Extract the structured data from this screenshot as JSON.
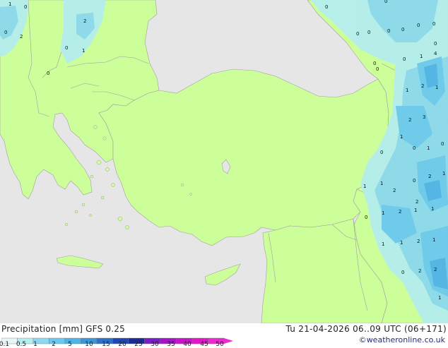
{
  "map": {
    "land_color": "#ccff99",
    "sea_color": "#e6e6e6",
    "border_color": "#a0a0a0",
    "precip_light": "#b4eeee",
    "precip_mid": "#8cd9ee",
    "precip_heavy": "#4fb3e8",
    "labels": [
      {
        "v": "1"
      },
      {
        "v": "0"
      },
      {
        "v": "2"
      },
      {
        "v": "0"
      },
      {
        "v": "2"
      },
      {
        "v": "0"
      },
      {
        "v": "1"
      },
      {
        "v": "0"
      },
      {
        "v": "0"
      },
      {
        "v": "0"
      },
      {
        "v": "0"
      },
      {
        "v": "0"
      },
      {
        "v": "0"
      },
      {
        "v": "0"
      },
      {
        "v": "0"
      },
      {
        "v": "0"
      },
      {
        "v": "0"
      },
      {
        "v": "0"
      },
      {
        "v": "0"
      },
      {
        "v": "1"
      },
      {
        "v": "4"
      },
      {
        "v": "0"
      },
      {
        "v": "1"
      },
      {
        "v": "2"
      },
      {
        "v": "1"
      },
      {
        "v": "2"
      },
      {
        "v": "3"
      },
      {
        "v": "1"
      },
      {
        "v": "0"
      },
      {
        "v": "1"
      },
      {
        "v": "0"
      },
      {
        "v": "0"
      },
      {
        "v": "2"
      },
      {
        "v": "1"
      },
      {
        "v": "1"
      },
      {
        "v": "1"
      },
      {
        "v": "0"
      },
      {
        "v": "2"
      },
      {
        "v": "2"
      },
      {
        "v": "0"
      },
      {
        "v": "1"
      },
      {
        "v": "2"
      },
      {
        "v": "1"
      },
      {
        "v": "1"
      },
      {
        "v": "1"
      },
      {
        "v": "1"
      },
      {
        "v": "2"
      },
      {
        "v": "1"
      },
      {
        "v": "0"
      },
      {
        "v": "2"
      },
      {
        "v": "2"
      },
      {
        "v": "1"
      }
    ]
  },
  "footer": {
    "title_left": "Precipitation [mm]  GFS 0.25",
    "title_right": "Tu 21-04-2026 06..09 UTC (06+171)",
    "credit": "©weatheronline.co.uk"
  },
  "legend": {
    "ticks": [
      "0.1",
      "0.5",
      "1",
      "2",
      "5",
      "10",
      "15",
      "20",
      "25",
      "30",
      "35",
      "40",
      "45",
      "50"
    ],
    "colors": [
      "#e6f7f7",
      "#b4eeee",
      "#8cd9ee",
      "#6cc8ee",
      "#4fb3e8",
      "#3c96d8",
      "#2e6fc8",
      "#1f46b4",
      "#1c2a96",
      "#7a1cc8",
      "#a614c8",
      "#c814c8",
      "#e614c8",
      "#f028d2"
    ]
  }
}
